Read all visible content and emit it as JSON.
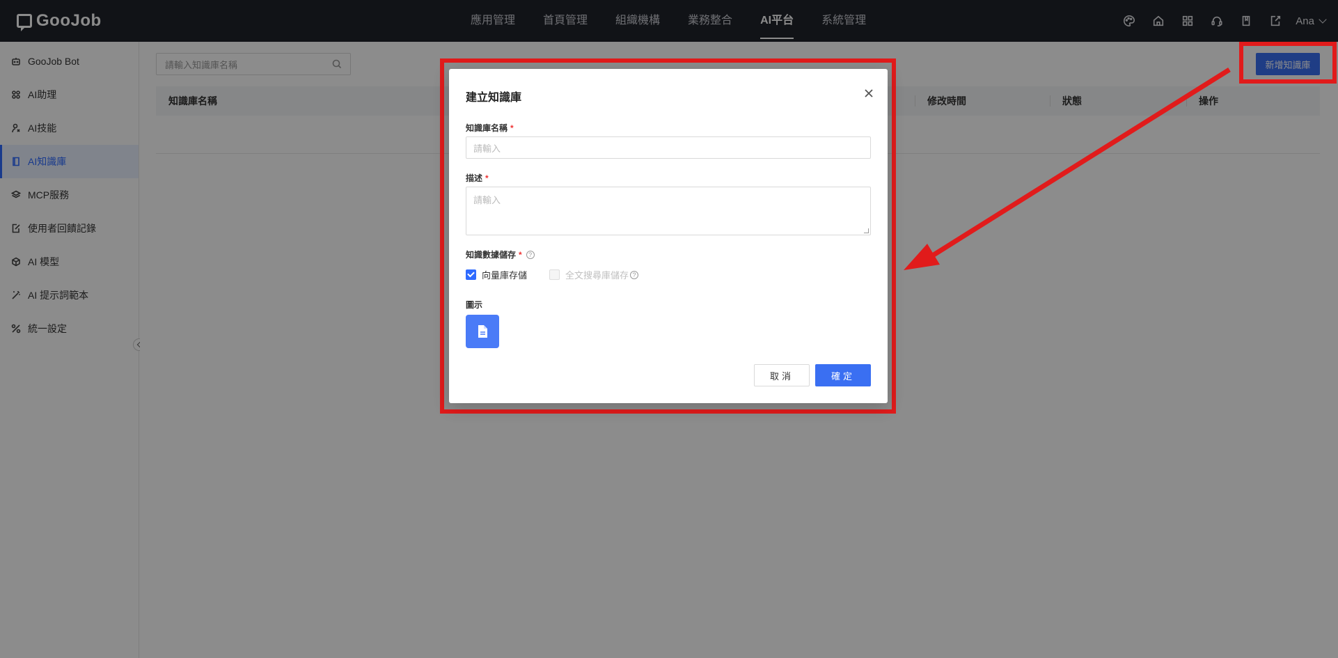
{
  "brand": {
    "name": "GooJob"
  },
  "nav": {
    "items": [
      "應用管理",
      "首頁管理",
      "組織機構",
      "業務整合",
      "AI平台",
      "系統管理"
    ],
    "active_index": 4
  },
  "user": {
    "name": "Ana"
  },
  "top_icons": [
    "palette-icon",
    "home-icon",
    "grid-icon",
    "headset-icon",
    "book-icon",
    "export-icon"
  ],
  "sidebar": {
    "items": [
      {
        "label": "GooJob Bot",
        "icon": "robot-icon"
      },
      {
        "label": "AI助理",
        "icon": "apps-icon"
      },
      {
        "label": "AI技能",
        "icon": "skill-icon"
      },
      {
        "label": "AI知識庫",
        "icon": "book-icon",
        "active": true
      },
      {
        "label": "MCP服務",
        "icon": "layers-icon"
      },
      {
        "label": "使用者回饋記錄",
        "icon": "edit-doc-icon"
      },
      {
        "label": "AI 模型",
        "icon": "cube-icon"
      },
      {
        "label": "AI 提示詞範本",
        "icon": "magic-wand-icon"
      },
      {
        "label": "統一設定",
        "icon": "tools-icon"
      }
    ]
  },
  "main": {
    "search_placeholder": "請輸入知識庫名稱",
    "add_button": "新增知識庫",
    "columns": [
      "知識庫名稱",
      "修改時間",
      "狀態",
      "操作"
    ]
  },
  "modal": {
    "title": "建立知識庫",
    "name_label": "知識庫名稱",
    "name_placeholder": "請輸入",
    "desc_label": "描述",
    "desc_placeholder": "請輸入",
    "storage_label": "知識數據儲存",
    "storage_options": [
      {
        "label": "向量庫存儲",
        "checked": true,
        "disabled": false
      },
      {
        "label": "全文搜尋庫儲存",
        "checked": false,
        "disabled": true
      }
    ],
    "icon_label": "圖示",
    "cancel": "取消",
    "ok": "確定"
  },
  "colors": {
    "topbar": "#20232b",
    "accent": "#3a6ff2",
    "highlight": "#e11b1b"
  }
}
